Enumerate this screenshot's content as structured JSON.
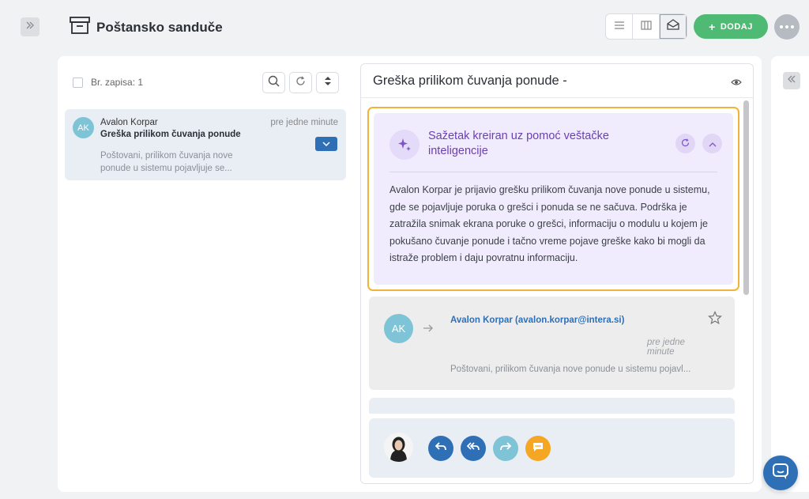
{
  "app": {
    "title": "Poštansko sanduče"
  },
  "toolbar": {
    "add_label": "DODAJ"
  },
  "list": {
    "count_label": "Br. zapisa: 1"
  },
  "messages": [
    {
      "avatar": "AK",
      "sender": "Avalon Korpar",
      "subject": "Greška prilikom čuvanja ponude",
      "time": "pre jedne minute",
      "preview": "Poštovani, prilikom čuvanja nove ponude u sistemu pojavljuje se..."
    }
  ],
  "detail": {
    "title": "Greška prilikom čuvanja ponude -",
    "ai": {
      "title": "Sažetak kreiran uz pomoć veštačke inteligencije",
      "summary": "Avalon Korpar je prijavio grešku prilikom čuvanja nove ponude u sistemu, gde se pojavljuje poruka o grešci i ponuda se ne sačuva. Podrška je zatražila snimak ekrana poruke o grešci, informaciju o modulu u kojem je pokušano čuvanje ponude i tačno vreme pojave greške kako bi mogli da istraže problem i daju povratnu informaciju."
    },
    "email": {
      "avatar": "AK",
      "from": "Avalon Korpar (avalon.korpar@intera.si)",
      "time": "pre jedne minute",
      "preview": "Poštovani, prilikom čuvanja nove ponude u sistemu pojavl..."
    }
  },
  "colors": {
    "accent_blue": "#2f6fb6",
    "add_green": "#4fba73",
    "ai_border": "#f0b43c",
    "ai_background": "#f1ecfd",
    "ai_text": "#6a3fb0",
    "forward": "#7ec3d6",
    "comment": "#f5a623"
  },
  "icons": [
    "sidebar-expand-icon",
    "inbox-icon",
    "list-view-icon",
    "columns-view-icon",
    "envelope-open-icon",
    "plus-icon",
    "more-icon",
    "search-icon",
    "refresh-icon",
    "sort-icon",
    "chevron-down-icon",
    "eye-icon",
    "sparkles-icon",
    "chevron-up-icon",
    "arrow-right-icon",
    "star-icon",
    "reply-icon",
    "reply-all-icon",
    "forward-icon",
    "comment-icon",
    "chat-icon",
    "sidebar-collapse-icon"
  ]
}
